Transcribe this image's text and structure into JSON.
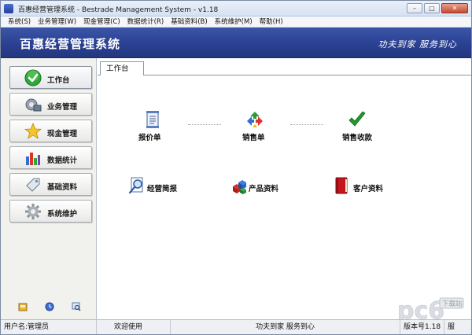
{
  "window": {
    "title": "百惠经营管理系统 - Bestrade Management System - v1.18",
    "buttons": {
      "minimize": "–",
      "maximize": "□",
      "close": "✕"
    }
  },
  "menu": {
    "items": [
      "系统(S)",
      "业务管理(W)",
      "现金管理(C)",
      "数据统计(R)",
      "基础资料(B)",
      "系统维护(M)",
      "帮助(H)"
    ]
  },
  "banner": {
    "title": "百惠经营管理系统",
    "slogan": "功夫到家 服务到心"
  },
  "sidebar": {
    "items": [
      {
        "label": "工作台",
        "icon": "check-circle-icon"
      },
      {
        "label": "业务管理",
        "icon": "gear-wheel-icon"
      },
      {
        "label": "现金管理",
        "icon": "star-icon"
      },
      {
        "label": "数据统计",
        "icon": "bar-chart-icon"
      },
      {
        "label": "基础资料",
        "icon": "tag-icon"
      },
      {
        "label": "系统维护",
        "icon": "settings-gear-icon"
      }
    ],
    "bottom_icons": [
      "lock-icon",
      "clock-icon",
      "search-icon"
    ]
  },
  "main": {
    "tab_label": "工作台",
    "items": [
      {
        "label": "报价单",
        "icon": "document-icon"
      },
      {
        "label": "销售单",
        "icon": "recycle-arrows-icon"
      },
      {
        "label": "销售收款",
        "icon": "checkmark-icon"
      },
      {
        "label": "经营简报",
        "icon": "magnifier-report-icon"
      },
      {
        "label": "产品资料",
        "icon": "cubes-icon"
      },
      {
        "label": "客户资料",
        "icon": "red-book-icon"
      }
    ]
  },
  "statusbar": {
    "user": "用户名:管理员",
    "welcome": "欢迎使用",
    "slogan": "功夫到家 服务到心",
    "version": "版本号1.18",
    "extra": "服"
  },
  "watermark": {
    "text": "pc6",
    "subtext": "下载站"
  },
  "colors": {
    "banner": "#2a3f90",
    "accent_green": "#1f9a2e",
    "book_red": "#c4161c"
  }
}
